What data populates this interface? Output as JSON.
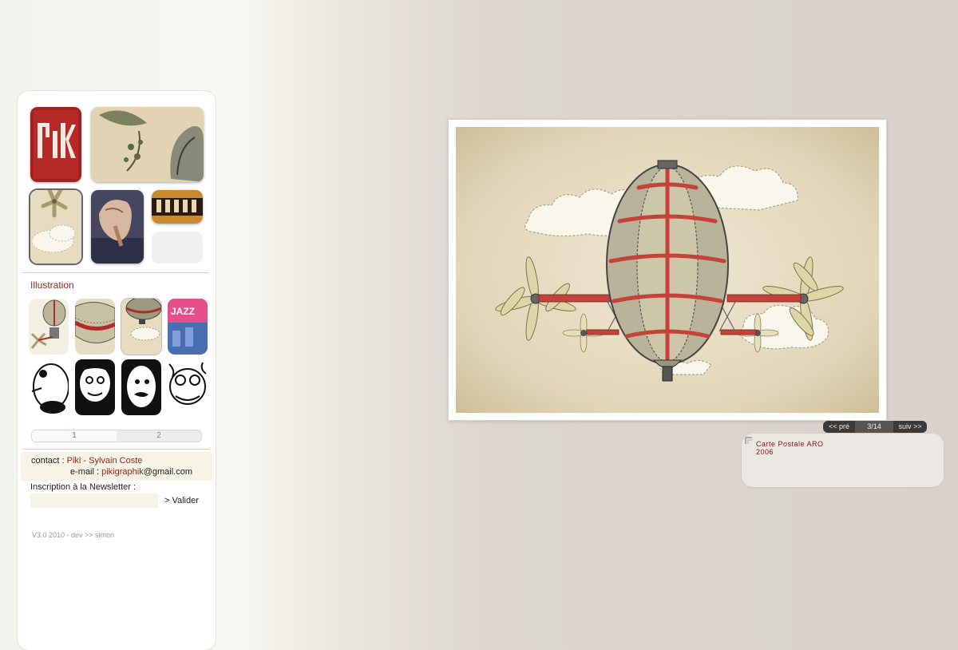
{
  "sidebar": {
    "section_title": "Illustration",
    "pages": [
      "1",
      "2"
    ],
    "active_page": "1",
    "contact": {
      "label": "contact :",
      "name": "Piki - Sylvain Coste",
      "email_label": "e-mail :",
      "email_user": "pikigraphik",
      "email_domain": "@gmail.com"
    },
    "newsletter": {
      "label": "Inscription à la Newsletter :",
      "placeholder": "",
      "submit": "> Valider"
    },
    "credits": "V3.0 2010 - dev >> simon",
    "logo_text": "PiKi"
  },
  "viewer": {
    "prev": "<< pré",
    "counter": "3/14",
    "next": "suiv >>",
    "caption_title": "Carte Postale ARO",
    "caption_year": "2006"
  },
  "colors": {
    "accent": "#8b2a1f",
    "panel": "#ffffff",
    "field_bg": "#f7f3e6"
  }
}
